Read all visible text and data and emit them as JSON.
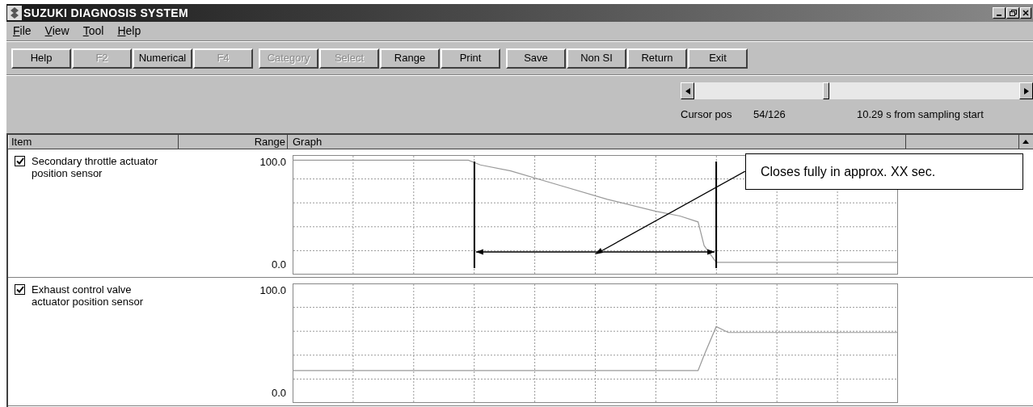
{
  "window": {
    "title": "SUZUKI DIAGNOSIS SYSTEM"
  },
  "menu": [
    "File",
    "View",
    "Tool",
    "Help"
  ],
  "toolbar": [
    [
      {
        "label": "Help",
        "disabled": false
      },
      {
        "label": "F2",
        "disabled": true
      },
      {
        "label": "Numerical",
        "disabled": false
      },
      {
        "label": "F4",
        "disabled": true
      }
    ],
    [
      {
        "label": "Category",
        "disabled": true
      },
      {
        "label": "Select",
        "disabled": true
      },
      {
        "label": "Range",
        "disabled": false
      },
      {
        "label": "Print",
        "disabled": false
      }
    ],
    [
      {
        "label": "Save",
        "disabled": false
      },
      {
        "label": "Non SI",
        "disabled": false
      },
      {
        "label": "Return",
        "disabled": false
      },
      {
        "label": "Exit",
        "disabled": false
      }
    ]
  ],
  "cursor": {
    "label": "Cursor pos",
    "position": "54/126",
    "time": "10.29 s from sampling start"
  },
  "table": {
    "columns": [
      "Item",
      "Range",
      "Graph"
    ],
    "rows": [
      {
        "item": "Secondary throttle actuator position sensor",
        "checked": true,
        "range_max": "100.0",
        "range_min": "0.0",
        "callout": "Closes fully in approx. XX sec."
      },
      {
        "item": "Exhaust control valve actuator position sensor",
        "checked": true,
        "range_max": "100.0",
        "range_min": "0.0"
      }
    ]
  }
}
